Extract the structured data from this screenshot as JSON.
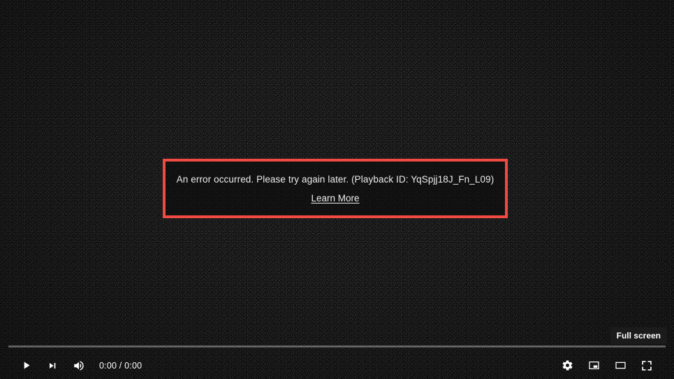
{
  "player": {
    "name": "video-player",
    "background_color": "#131313",
    "accent_color": "#ff0000"
  },
  "error": {
    "message": "An error occurred. Please try again later. (Playback ID: YqSpjj18J_Fn_L09)",
    "playback_id": "YqSpjj18J_Fn_L09",
    "learn_more_label": "Learn More",
    "border_color": "#f04a42"
  },
  "tooltip": {
    "label": "Full screen"
  },
  "controls": {
    "play_icon": "play-icon",
    "next_icon": "next-track-icon",
    "volume_icon": "volume-icon",
    "time_display": "0:00 / 0:00",
    "current_time": "0:00",
    "duration": "0:00",
    "settings_icon": "gear-icon",
    "miniplayer_icon": "miniplayer-icon",
    "theater_icon": "theater-mode-icon",
    "fullscreen_icon": "fullscreen-icon",
    "progress_percent": 0
  }
}
